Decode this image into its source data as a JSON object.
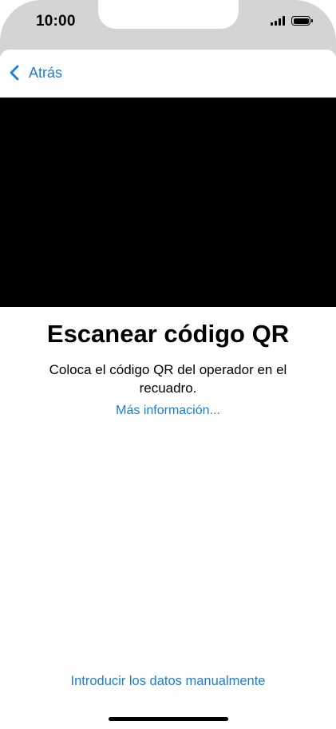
{
  "status_bar": {
    "time": "10:00"
  },
  "nav": {
    "back_label": "Atrás"
  },
  "content": {
    "title": "Escanear código QR",
    "subtitle": "Coloca el código QR del operador en el recuadro.",
    "more_info_link": "Más información...",
    "manual_entry_link": "Introducir los datos manualmente"
  },
  "icons": {
    "back": "chevron-left-icon",
    "signal": "cellular-signal-icon",
    "battery": "battery-icon"
  },
  "colors": {
    "accent": "#1a7fd1",
    "status_background": "#d4d4d4",
    "camera_view": "#000000"
  }
}
